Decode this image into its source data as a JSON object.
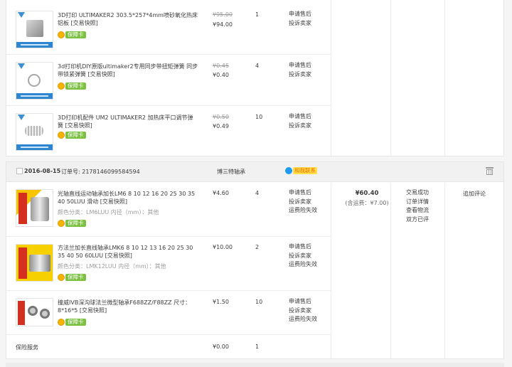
{
  "order1": {
    "items": [
      {
        "title": "3D打印 ULTIMAKER2 303.5*257*4mm喷砂氧化热床铝板 [交易快照]",
        "price_original": "¥95.00",
        "price": "¥94.00",
        "qty": "1",
        "actions": [
          "申请售后",
          "投诉卖家"
        ],
        "guarantee": "保障卡"
      },
      {
        "title": "3d打印机DIY原版ultimaker2专用同步带扭矩弹簧 同步带锁紧弹簧 [交易快照]",
        "price_original": "¥0.45",
        "price": "¥0.40",
        "qty": "4",
        "actions": [
          "申请售后",
          "投诉卖家"
        ],
        "guarantee": "保障卡"
      },
      {
        "title": "3D打印机配件 UM2 ULTIMAKER2 加热床平口调节弹簧 [交易快照]",
        "price_original": "¥0.50",
        "price": "¥0.49",
        "qty": "10",
        "actions": [
          "申请售后",
          "投诉卖家"
        ],
        "guarantee": "保障卡"
      }
    ]
  },
  "order2": {
    "date": "2016-08-15",
    "order_label": "订单号:",
    "order_no": "2178146099584594",
    "shop": "博三特轴承",
    "wangwang": "和我联系",
    "items": [
      {
        "title": "光轴直线运动轴承加长LM6 8 10 12 16 20 25 30 35 40 50LUU 滑动 [交易快照]",
        "sku": "颜色分类：LM6LUU  内径（mm）：其他",
        "price": "¥4.60",
        "qty": "4",
        "actions": [
          "申请售后",
          "投诉卖家",
          "运费险失效"
        ],
        "guarantee": "保障卡"
      },
      {
        "title": "方法兰加长直线轴承LMK6 8 10 12 13 16 20 25 30 35 40 50 60LUU [交易快照]",
        "sku": "颜色分类：LMK12LUU  内径（mm）：其他",
        "price": "¥10.00",
        "qty": "2",
        "actions": [
          "申请售后",
          "投诉卖家",
          "运费险失效"
        ],
        "guarantee": "保障卡"
      },
      {
        "title": "撞威IVB深沟球法兰微型轴承F688ZZ/F88ZZ 尺寸：8*16*5 [交易快照]",
        "sku": "",
        "price": "¥1.50",
        "qty": "10",
        "actions": [
          "申请售后",
          "投诉卖家",
          "运费险失效"
        ],
        "guarantee": "保障卡"
      }
    ],
    "insurance": {
      "label": "保险服务",
      "price": "¥0.00",
      "qty": "1"
    },
    "total": "¥60.40",
    "shipping": "(含运费：¥7.00)",
    "status": [
      "交易成功",
      "订单详情",
      "查看物流",
      "双方已评"
    ],
    "review": "追加评论"
  }
}
